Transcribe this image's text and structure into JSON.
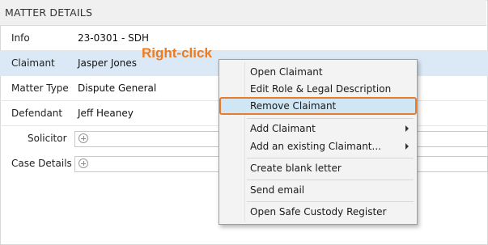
{
  "header": {
    "title": "MATTER DETAILS"
  },
  "fields": {
    "info": {
      "label": "Info",
      "value": "23-0301 - SDH"
    },
    "claimant": {
      "label": "Claimant",
      "value": "Jasper Jones"
    },
    "matter_type": {
      "label": "Matter Type",
      "value": "Dispute General"
    },
    "defendant": {
      "label": "Defendant",
      "value": "Jeff Heaney"
    },
    "solicitor": {
      "label": "Solicitor"
    },
    "case_details": {
      "label": "Case Details"
    }
  },
  "annotation": {
    "text": "Right-click",
    "color": "#f07a1e"
  },
  "context_menu": {
    "items": [
      {
        "label": "Open Claimant"
      },
      {
        "label": "Edit Role & Legal Description"
      },
      {
        "label": "Remove Claimant",
        "selected": true
      },
      {
        "label": "Add Claimant",
        "submenu": true
      },
      {
        "label": "Add an existing Claimant...",
        "submenu": true
      },
      {
        "label": "Create blank letter"
      },
      {
        "label": "Send email"
      },
      {
        "label": "Open Safe Custody Register"
      }
    ]
  },
  "colors": {
    "row_highlight": "#dbe9f6",
    "selected_item": "#cfe6f5",
    "selected_border": "#ea7a2c"
  },
  "icons": [
    "plus-circle-icon",
    "submenu-arrow-icon"
  ]
}
